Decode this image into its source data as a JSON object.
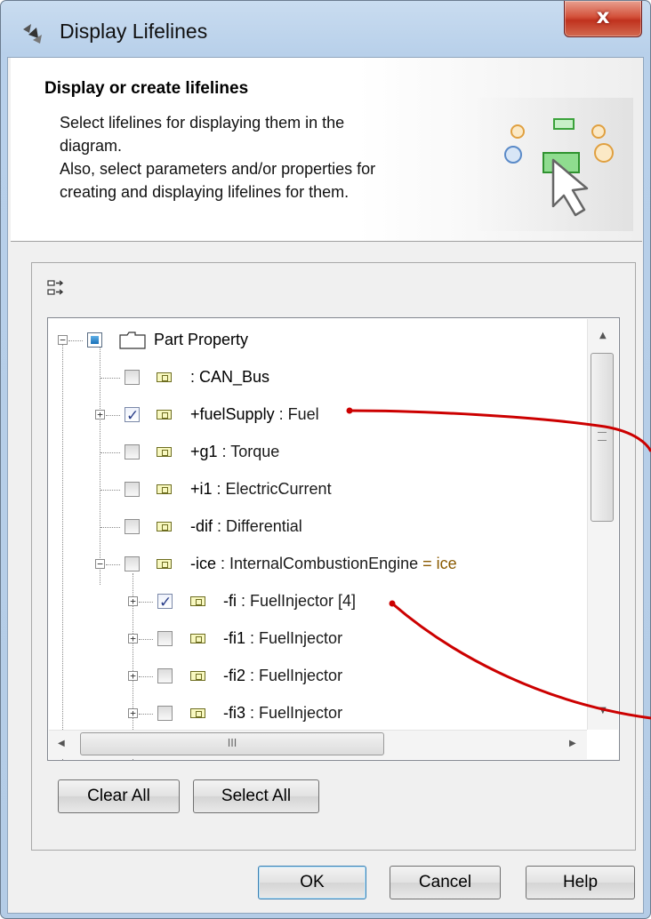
{
  "window": {
    "title": "Display Lifelines",
    "close_symbol": "x"
  },
  "header": {
    "title": "Display or create lifelines",
    "desc_lines": [
      "Select lifelines for displaying them in the",
      "diagram.",
      "Also, select parameters and/or properties for",
      "creating and displaying lifelines for them."
    ]
  },
  "tree": {
    "root": {
      "label": "Part Property"
    },
    "items": [
      {
        "name": ": CAN_Bus",
        "type": "",
        "extra": "",
        "checked": false
      },
      {
        "name": "+fuelSupply",
        "type": " : Fuel",
        "extra": "",
        "checked": true
      },
      {
        "name": "+g1",
        "type": " : Torque",
        "extra": "",
        "checked": false
      },
      {
        "name": "+i1",
        "type": " : ElectricCurrent",
        "extra": "",
        "checked": false
      },
      {
        "name": "-dif",
        "type": " : Differential",
        "extra": "",
        "checked": false
      },
      {
        "name": "-ice",
        "type": " : InternalCombustionEngine",
        "extra": " = ice",
        "checked": false
      },
      {
        "name": "-fi",
        "type": " : FuelInjector",
        "extra": " [4]",
        "checked": true
      },
      {
        "name": "-fi1",
        "type": " : FuelInjector",
        "extra": "",
        "checked": false
      },
      {
        "name": "-fi2",
        "type": " : FuelInjector",
        "extra": "",
        "checked": false
      },
      {
        "name": "-fi3",
        "type": " : FuelInjector",
        "extra": "",
        "checked": false
      }
    ],
    "hscroll_grip": "III"
  },
  "buttons": {
    "clear_all": "Clear All",
    "select_all": "Select All",
    "ok": "OK",
    "cancel": "Cancel",
    "help": "Help"
  },
  "colors": {
    "annotation_line": "#cc0000",
    "titlebar": "#c2d7ee",
    "close_button": "#c7432b"
  }
}
